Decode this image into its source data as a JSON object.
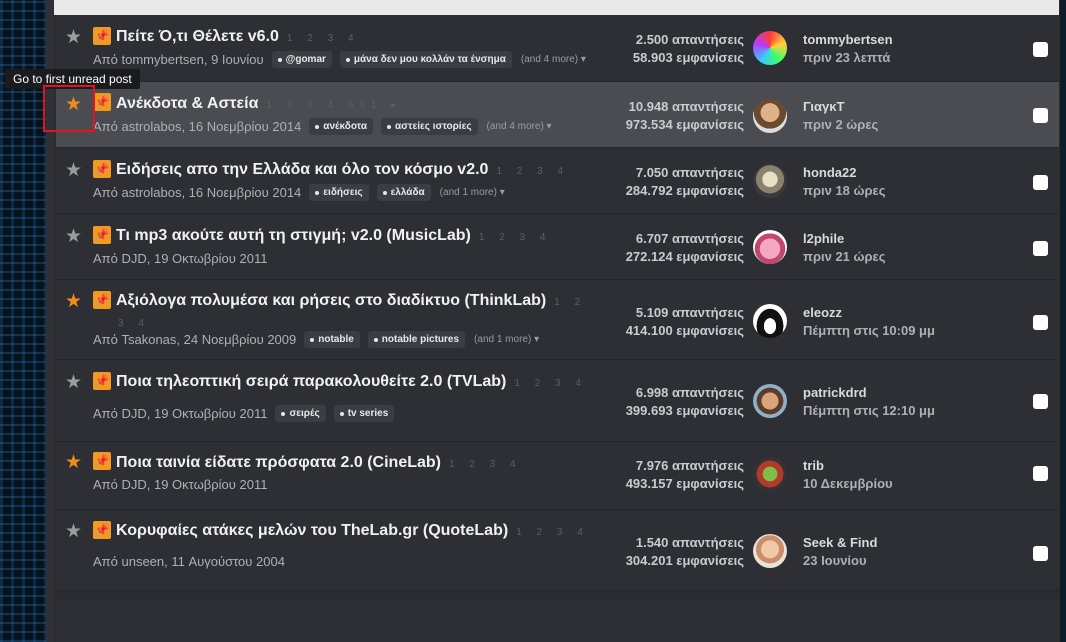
{
  "tooltip": "Go to first unread post",
  "columns": {
    "replies_suffix": "απαντήσεις",
    "views_suffix": "εμφανίσεις"
  },
  "topics": [
    {
      "title": "Πείτε Ό,τι Θέλετε v6.0",
      "pages": "1 2 3 4",
      "meta": "Από tommybertsen, 9 Ιουνίου",
      "tags": [
        "@gomar",
        "μάνα δεν μου κολλάν τα ένσημα"
      ],
      "more": "(and 4 more) ▾",
      "replies": "2.500 απαντήσεις",
      "views": "58.903 εμφανίσεις",
      "user": "tommybertsen",
      "time": "πριν 23 λεπτά",
      "starred": false
    },
    {
      "title": "Ανέκδοτα & Αστεία",
      "pages": "1 2 3 4 551 ▸",
      "meta": "Από astrolabos, 16 Νοεμβρίου 2014",
      "tags": [
        "ανέκδοτα",
        "αστείες ιστορίες"
      ],
      "more": "(and 4 more) ▾",
      "replies": "10.948 απαντήσεις",
      "views": "973.534 εμφανίσεις",
      "user": "ΓιαγκT",
      "time": "πριν 2 ώρες",
      "starred": true
    },
    {
      "title": "Ειδήσεις απο την Ελλάδα και όλο τον κόσμο v2.0",
      "pages": "1 2 3 4",
      "meta": "Από astrolabos, 16 Νοεμβρίου 2014",
      "tags": [
        "ειδήσεις",
        "ελλάδα"
      ],
      "more": "(and 1 more) ▾",
      "replies": "7.050 απαντήσεις",
      "views": "284.792 εμφανίσεις",
      "user": "honda22",
      "time": "πριν 18 ώρες",
      "starred": false
    },
    {
      "title": "Τι mp3 ακούτε αυτή τη στιγμή; v2.0 (MusicLab)",
      "pages": "1 2 3 4",
      "meta": "Από DJD, 19 Οκτωβρίου 2011",
      "tags": [],
      "more": "",
      "replies": "6.707 απαντήσεις",
      "views": "272.124 εμφανίσεις",
      "user": "l2phile",
      "time": "πριν 21 ώρες",
      "starred": false
    },
    {
      "title": "Αξιόλογα πολυμέσα και ρήσεις στο διαδίκτυο (ThinkLab)",
      "pages": "1 2",
      "pages_cont": "3 4",
      "meta": "Από Tsakonas, 24 Νοεμβρίου 2009",
      "tags": [
        "notable",
        "notable pictures"
      ],
      "more": "(and 1 more) ▾",
      "replies": "5.109 απαντήσεις",
      "views": "414.100 εμφανίσεις",
      "user": "eleozz",
      "time": "Πέμπτη στις 10:09 μμ",
      "starred": true
    },
    {
      "title": "Ποια τηλεοπτική σειρά παρακολουθείτε 2.0 (TVLab)",
      "pages": "1 2 3 4",
      "meta": "Από DJD, 19 Οκτωβρίου 2011",
      "tags": [
        "σειρές",
        "tv series"
      ],
      "more": "",
      "replies": "6.998 απαντήσεις",
      "views": "399.693 εμφανίσεις",
      "user": "patrickdrd",
      "time": "Πέμπτη στις 12:10 μμ",
      "starred": false
    },
    {
      "title": "Ποια ταινία είδατε πρόσφατα 2.0 (CineLab)",
      "pages": "1 2 3 4",
      "meta": "Από DJD, 19 Οκτωβρίου 2011",
      "tags": [],
      "more": "",
      "replies": "7.976 απαντήσεις",
      "views": "493.157 εμφανίσεις",
      "user": "trib",
      "time": "10 Δεκεμβρίου",
      "starred": true
    },
    {
      "title": "Κορυφαίες ατάκες μελών του TheLab.gr (QuoteLab)",
      "pages": "1 2 3 4",
      "meta": "Από unseen, 11 Αυγούστου 2004",
      "tags": [],
      "more": "",
      "replies": "1.540 απαντήσεις",
      "views": "304.201 εμφανίσεις",
      "user": "Seek & Find",
      "time": "23 Ιουνίου",
      "starred": false
    }
  ]
}
